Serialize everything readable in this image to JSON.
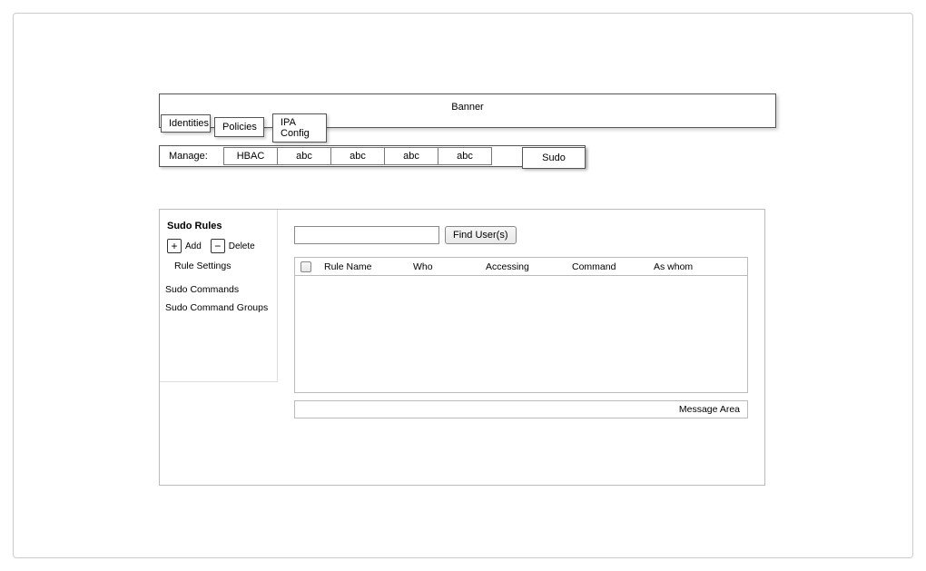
{
  "banner": {
    "title": "Banner"
  },
  "tabs": {
    "identities": "Identities",
    "policies": "Policies",
    "ipaconfig": "IPA Config"
  },
  "subnav": {
    "label": "Manage:",
    "items": [
      "HBAC",
      "abc",
      "abc",
      "abc",
      "abc"
    ],
    "sudo": "Sudo"
  },
  "sidebar": {
    "title": "Sudo Rules",
    "add_label": "Add",
    "delete_label": "Delete",
    "rule_settings": "Rule Settings",
    "sudo_commands": "Sudo Commands",
    "sudo_command_groups": "Sudo Command Groups"
  },
  "search": {
    "placeholder": "",
    "button": "Find User(s)"
  },
  "table": {
    "columns": [
      "Rule Name",
      "Who",
      "Accessing",
      "Command",
      "As whom"
    ]
  },
  "message_area": "Message Area"
}
